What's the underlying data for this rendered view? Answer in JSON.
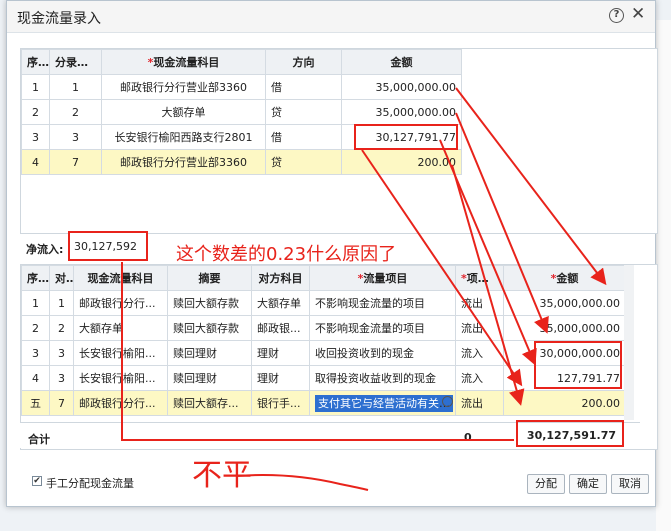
{
  "dialog": {
    "title": "现金流量录入"
  },
  "top_table": {
    "headers": {
      "seq": "序号",
      "entry": "分录序号",
      "item": "现金流量科目",
      "dir": "方向",
      "amount": "金额"
    },
    "rows": [
      {
        "seq": "1",
        "entry": "1",
        "item": "邮政银行分行营业部3360",
        "dir": "借",
        "amount": "35,000,000.00"
      },
      {
        "seq": "2",
        "entry": "2",
        "item": "大额存单",
        "dir": "贷",
        "amount": "35,000,000.00"
      },
      {
        "seq": "3",
        "entry": "3",
        "item": "长安银行榆阳西路支行2801",
        "dir": "借",
        "amount": "30,127,791.77"
      },
      {
        "seq": "4",
        "entry": "7",
        "item": "邮政银行分行营业部3360",
        "dir": "贷",
        "amount": "200.00"
      }
    ]
  },
  "net_inflow": {
    "label": "净流入:",
    "value": "30,127,592"
  },
  "annotation": "这个数差的0.23什么原因了",
  "handwriting": "不平",
  "bottom_table": {
    "headers": {
      "seq": "序号",
      "entry": "对...",
      "item": "现金流量科目",
      "memo": "摘要",
      "counter": "对方科目",
      "flow_item": "流量项目",
      "flow_type": "项目...",
      "amount": "金额"
    },
    "rows": [
      {
        "seq": "1",
        "entry": "1",
        "item": "邮政银行分行...",
        "memo": "赎回大额存款",
        "counter": "大额存单",
        "flow_item": "不影响现金流量的项目",
        "flow_type": "流出",
        "amount": "35,000,000.00"
      },
      {
        "seq": "2",
        "entry": "2",
        "item": "大额存单",
        "memo": "赎回大额存款",
        "counter": "邮政银...",
        "flow_item": "不影响现金流量的项目",
        "flow_type": "流出",
        "amount": "35,000,000.00"
      },
      {
        "seq": "3",
        "entry": "3",
        "item": "长安银行榆阳...",
        "memo": "赎回理财",
        "counter": "理财",
        "flow_item": "收回投资收到的现金",
        "flow_type": "流入",
        "amount": "30,000,000.00"
      },
      {
        "seq": "4",
        "entry": "3",
        "item": "长安银行榆阳...",
        "memo": "赎回理财",
        "counter": "理财",
        "flow_item": "取得投资收益收到的现金",
        "flow_type": "流入",
        "amount": "127,791.77"
      },
      {
        "seq": "五",
        "entry": "7",
        "item": "邮政银行分行...",
        "memo": "赎回大额存...",
        "counter": "银行手...",
        "flow_item": "支付其它与经营活动有关的",
        "flow_type": "流出",
        "amount": "200.00"
      }
    ],
    "total": {
      "label": "合计",
      "zero": "0",
      "amount": "30,127,591.77"
    }
  },
  "manual_alloc": {
    "label": "手工分配现金流量",
    "checked": true
  },
  "buttons": {
    "allocate": "分配",
    "confirm": "确定",
    "cancel": "取消"
  },
  "colors": {
    "annotation_red": "#e8231b",
    "highlight_row": "#fdf8c4",
    "selection_blue": "#2d6fd0"
  }
}
